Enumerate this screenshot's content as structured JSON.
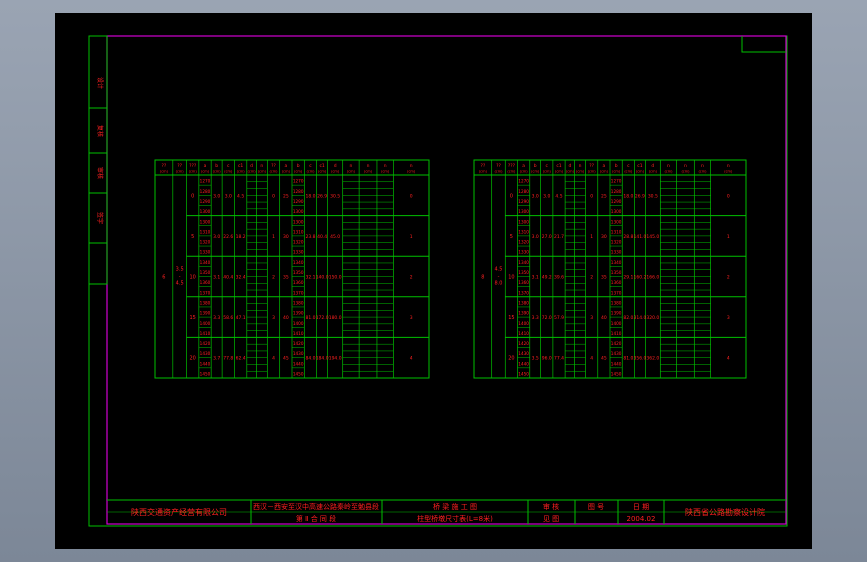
{
  "title_block": {
    "company": "陕西交通资产经营有限公司",
    "project_line1": "西汉－西安至汉中高速公路秦岭至勉县段",
    "project_line2": "第 Ⅱ 合 同 段",
    "drawing_title_line1": "桥 梁 施 工 图",
    "drawing_title_line2": "柱型桥墩尺寸表(L=8米)",
    "approved_label": "审 核",
    "drawing_no_label": "图 号",
    "date_label": "日 期",
    "sheet_label": "见 图",
    "date_value": "2004.02",
    "designer": "陕西省公路勘察设计院"
  },
  "side_labels": [
    "设计",
    "复核",
    "审核",
    "签字"
  ],
  "tables": [
    {
      "name": "left-table",
      "span_col": "6",
      "height_col": "3.5\n-\n4.5",
      "groups": [
        {
          "h": "0",
          "rows": [
            "1270",
            "1280",
            "1290",
            "1300"
          ],
          "a": "3.0",
          "b": "3.0",
          "c": "4.5",
          "d": "0",
          "e": "25",
          "f": "18.0",
          "g": "26.9",
          "h2": "30.5",
          "i": "0"
        },
        {
          "h": "5",
          "rows": [
            "1300",
            "1310",
            "1320",
            "1330"
          ],
          "a": "3.0",
          "b": "22.6",
          "c": "18.2",
          "d": "1",
          "e": "30",
          "f": "23.8",
          "g": "40.4",
          "h2": "45.0",
          "i": "1"
        },
        {
          "h": "10",
          "rows": [
            "1340",
            "1350",
            "1360",
            "1370"
          ],
          "a": "3.1",
          "b": "40.4",
          "c": "32.4",
          "d": "2",
          "e": "35",
          "f": "32.1",
          "g": "140.0",
          "h2": "150.0",
          "i": "2"
        },
        {
          "h": "15",
          "rows": [
            "1380",
            "1390",
            "1400",
            "1410"
          ],
          "a": "3.3",
          "b": "58.6",
          "c": "47.1",
          "d": "3",
          "e": "40",
          "f": "81.0",
          "g": "172.0",
          "h2": "180.0",
          "i": "3"
        },
        {
          "h": "20",
          "rows": [
            "1420",
            "1430",
            "1440",
            "1450"
          ],
          "a": "3.7",
          "b": "77.8",
          "c": "62.4",
          "d": "4",
          "e": "45",
          "f": "84.0",
          "g": "184.0",
          "h2": "194.0",
          "i": "4"
        }
      ]
    },
    {
      "name": "right-table",
      "span_col": "8",
      "height_col": "4.5\n-\n8.0",
      "groups": [
        {
          "h": "0",
          "rows": [
            "1270",
            "1280",
            "1290",
            "1300"
          ],
          "a": "3.0",
          "b": "3.0",
          "c": "4.5",
          "d": "0",
          "e": "25",
          "f": "18.0",
          "g": "26.9",
          "h2": "30.5",
          "i": "0"
        },
        {
          "h": "5",
          "rows": [
            "1300",
            "1310",
            "1320",
            "1330"
          ],
          "a": "3.0",
          "b": "27.0",
          "c": "21.7",
          "d": "1",
          "e": "30",
          "f": "28.8",
          "g": "141.0",
          "h2": "145.0",
          "i": "1"
        },
        {
          "h": "10",
          "rows": [
            "1340",
            "1350",
            "1360",
            "1370"
          ],
          "a": "3.1",
          "b": "49.2",
          "c": "39.6",
          "d": "2",
          "e": "35",
          "f": "29.1",
          "g": "160.2",
          "h2": "166.0",
          "i": "2"
        },
        {
          "h": "15",
          "rows": [
            "1380",
            "1390",
            "1400",
            "1410"
          ],
          "a": "3.3",
          "b": "72.0",
          "c": "57.9",
          "d": "3",
          "e": "40",
          "f": "82.0",
          "g": "314.0",
          "h2": "320.0",
          "i": "3"
        },
        {
          "h": "20",
          "rows": [
            "1420",
            "1430",
            "1440",
            "1450"
          ],
          "a": "3.5",
          "b": "96.0",
          "c": "77.4",
          "d": "4",
          "e": "45",
          "f": "81.0",
          "g": "356.0",
          "h2": "362.0",
          "i": "4"
        }
      ]
    }
  ],
  "table_header": [
    "??\n(m)",
    "??\n(m)",
    "???",
    "a\n(cm)",
    "b\n(cm)",
    "c\n(cm)",
    "c1\n(cm)",
    "d\n(cm)",
    "n",
    "??",
    "a\n(cm)",
    "b\n(cm)",
    "c\n(cm)",
    "c1\n(cm)",
    "d\n(cm)",
    "n",
    "n"
  ]
}
